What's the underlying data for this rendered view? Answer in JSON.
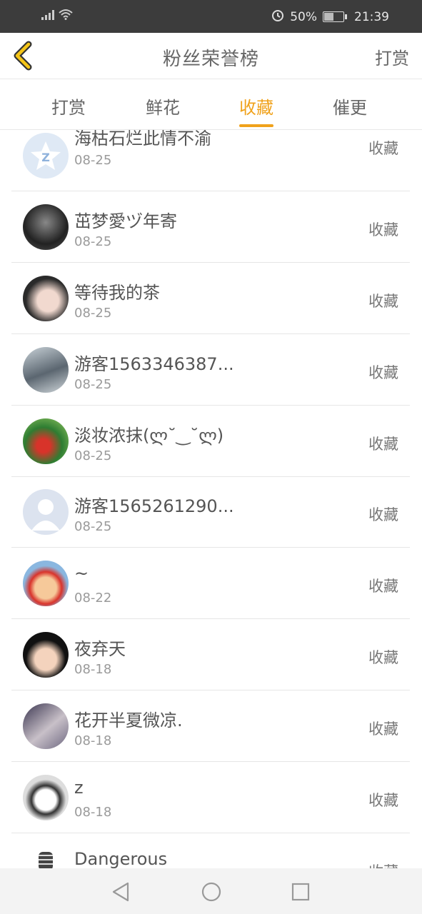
{
  "status": {
    "battery": "50%",
    "time": "21:39",
    "icons": [
      "signal-icon",
      "wifi-icon",
      "alarm-icon",
      "battery-icon"
    ]
  },
  "header": {
    "title": "粉丝荣誉榜",
    "action": "打赏"
  },
  "tabs": [
    {
      "label": "打赏",
      "active": false
    },
    {
      "label": "鲜花",
      "active": false
    },
    {
      "label": "收藏",
      "active": true
    },
    {
      "label": "催更",
      "active": false
    }
  ],
  "accent_color": "#f0a21c",
  "fans": [
    {
      "name": "海枯石烂此情不渝",
      "date": "08-25",
      "action": "收藏"
    },
    {
      "name": "茁梦愛ヅ年寄",
      "date": "08-25",
      "action": "收藏"
    },
    {
      "name": "等待我的茶",
      "date": "08-25",
      "action": "收藏"
    },
    {
      "name": "游客1563346387...",
      "date": "08-25",
      "action": "收藏"
    },
    {
      "name": "淡妆浓抹(ლ˘‿˘ლ)",
      "date": "08-25",
      "action": "收藏"
    },
    {
      "name": "游客1565261290...",
      "date": "08-25",
      "action": "收藏"
    },
    {
      "name": "~",
      "date": "08-22",
      "action": "收藏"
    },
    {
      "name": "夜弃天",
      "date": "08-18",
      "action": "收藏"
    },
    {
      "name": "花开半夏微凉.",
      "date": "08-18",
      "action": "收藏"
    },
    {
      "name": "z",
      "date": "08-18",
      "action": "收藏"
    },
    {
      "name": "Dangerous",
      "date": "",
      "action": "收藏"
    }
  ],
  "navbar": {
    "icons": [
      "back-triangle-icon",
      "home-circle-icon",
      "recents-square-icon"
    ]
  }
}
